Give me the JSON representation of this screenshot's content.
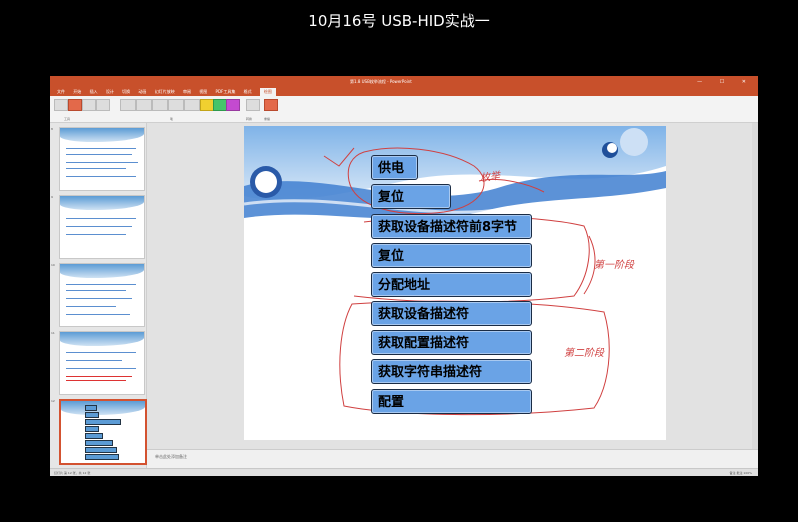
{
  "video": {
    "title": "10月16号 USB-HID实战一"
  },
  "app": {
    "title_center": "第1.8 USB枚举流程 - PowerPoint",
    "tabs": [
      "文件",
      "开始",
      "插入",
      "设计",
      "切换",
      "动画",
      "幻灯片放映",
      "审阅",
      "视图",
      "PDF工具集",
      "格式",
      "绘图"
    ],
    "active_tab": "绘图",
    "ribbon_groups": [
      "工具",
      "笔",
      "转换",
      "重播"
    ],
    "notes_placeholder": "单击此处添加备注",
    "status_left": "幻灯片 第 12 张，共 12 张",
    "status_right": "备注 批注 100%",
    "thumb_numbers": [
      "8",
      "9",
      "10",
      "11",
      "12"
    ]
  },
  "slide": {
    "steps": [
      "供电",
      "复位",
      "获取设备描述符前8字节",
      "复位",
      "分配地址",
      "获取设备描述符",
      "获取配置描述符",
      "获取字符串描述符",
      "配置"
    ],
    "annotations": {
      "first": "枚举",
      "second": "第一阶段",
      "third": "第二阶段"
    }
  },
  "colors": {
    "accent": "#c8502b",
    "step_fill": "#6aa3e6",
    "ink": "#d04040"
  }
}
